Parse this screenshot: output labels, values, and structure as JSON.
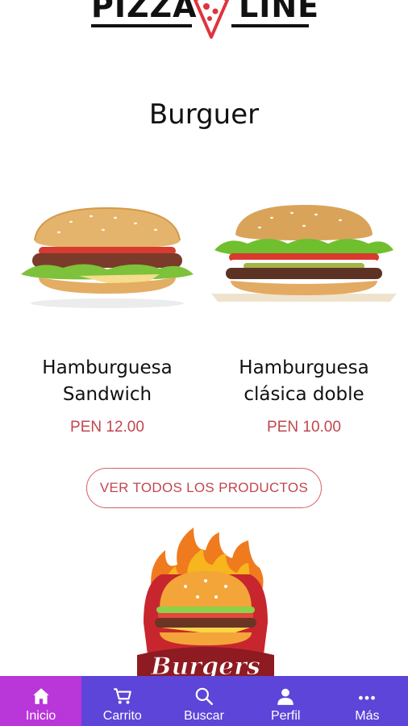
{
  "brand": {
    "left": "PIZZA",
    "right": "LINE"
  },
  "section": {
    "title": "Burguer"
  },
  "products": [
    {
      "name": "Hamburguesa\nSandwich",
      "price": "PEN 12.00"
    },
    {
      "name": "Hamburguesa\nclásica doble",
      "price": "PEN 10.00"
    }
  ],
  "view_all_label": "VER TODOS LOS PRODUCTOS",
  "promo": {
    "logo_text": "Burgers"
  },
  "nav": [
    {
      "label": "Inicio",
      "icon": "home-icon",
      "active": true
    },
    {
      "label": "Carrito",
      "icon": "cart-icon"
    },
    {
      "label": "Buscar",
      "icon": "search-icon"
    },
    {
      "label": "Perfil",
      "icon": "person-icon"
    },
    {
      "label": "Más",
      "icon": "more-icon"
    }
  ],
  "colors": {
    "nav_bg": "#5c45d8",
    "nav_active": "#b936d9",
    "price": "#c2464e",
    "accent_red": "#e0333d"
  }
}
